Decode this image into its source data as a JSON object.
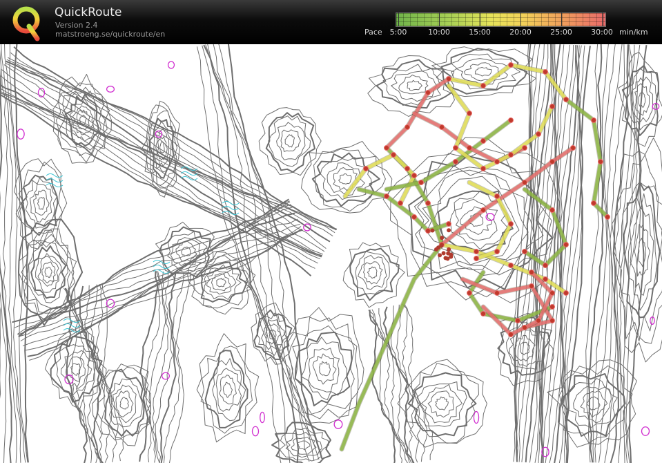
{
  "app": {
    "logo_letter": "Q",
    "name": "QuickRoute",
    "version": "Version 2.4",
    "url": "matstroeng.se/quickroute/en"
  },
  "legend": {
    "label": "Pace",
    "ticks": [
      "5:00",
      "10:00",
      "15:00",
      "20:00",
      "25:00",
      "30:00"
    ],
    "unit": "min/km",
    "colors": [
      "#6fb34a",
      "#a7cf55",
      "#e6e35a",
      "#f3d35a",
      "#f0a35c",
      "#e96a6a"
    ]
  },
  "map": {
    "contour_color": "#6e6e6e",
    "marsh_color": "#3fc7d6",
    "feature_color": "#d12fd0",
    "route_fast_color": "#8fb947",
    "route_slow_color": "#e97070"
  }
}
